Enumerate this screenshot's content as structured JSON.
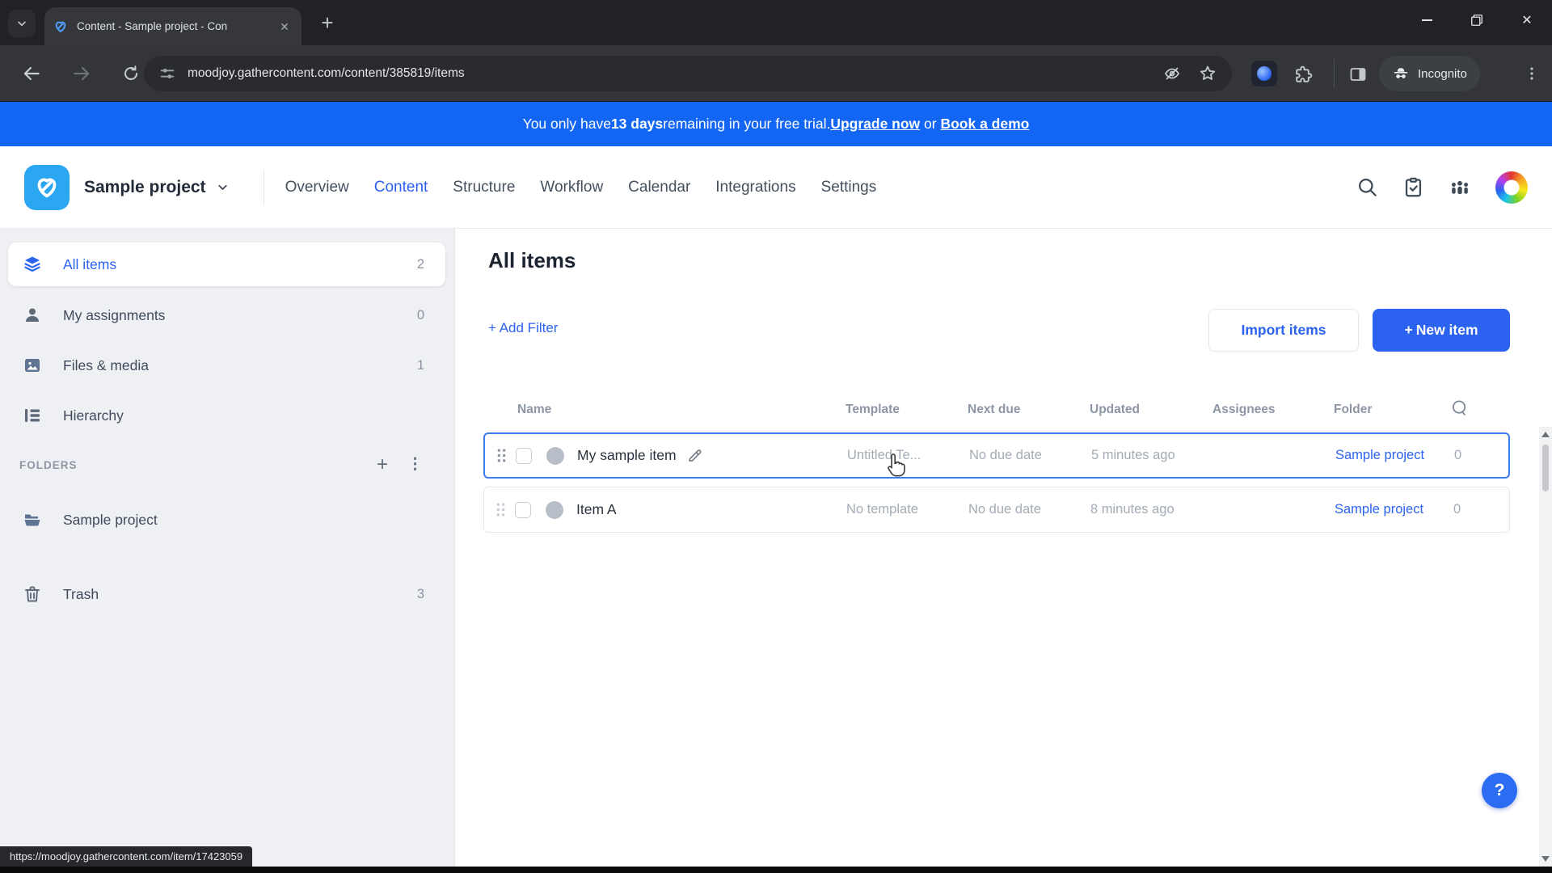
{
  "browser": {
    "tab_title": "Content - Sample project - Con",
    "url": "moodjoy.gathercontent.com/content/385819/items",
    "incognito_label": "Incognito",
    "status_link": "https://moodjoy.gathercontent.com/item/17423059"
  },
  "banner": {
    "text_prefix": "You only have ",
    "days_remaining": "13 days",
    "text_middle": " remaining in your free trial. ",
    "upgrade_link": "Upgrade now",
    "or_text": " or ",
    "demo_link": "Book a demo"
  },
  "header": {
    "project_name": "Sample project",
    "nav": [
      {
        "label": "Overview",
        "active": false
      },
      {
        "label": "Content",
        "active": true
      },
      {
        "label": "Structure",
        "active": false
      },
      {
        "label": "Workflow",
        "active": false
      },
      {
        "label": "Calendar",
        "active": false
      },
      {
        "label": "Integrations",
        "active": false
      },
      {
        "label": "Settings",
        "active": false
      }
    ]
  },
  "sidebar": {
    "items": [
      {
        "label": "All items",
        "count": "2",
        "icon": "layers-icon",
        "active": true
      },
      {
        "label": "My assignments",
        "count": "0",
        "icon": "person-icon",
        "active": false
      },
      {
        "label": "Files & media",
        "count": "1",
        "icon": "image-icon",
        "active": false
      },
      {
        "label": "Hierarchy",
        "count": "",
        "icon": "hierarchy-icon",
        "active": false
      }
    ],
    "folders_label": "FOLDERS",
    "folders": [
      {
        "label": "Sample project",
        "icon": "folder-icon"
      }
    ],
    "trash_label": "Trash",
    "trash_count": "3"
  },
  "main": {
    "title": "All items",
    "add_filter_label": "+ Add Filter",
    "import_button": "Import items",
    "new_item_plus": "+",
    "new_item_label": "New item",
    "help_label": "?",
    "table": {
      "columns": [
        "Name",
        "Template",
        "Next due",
        "Updated",
        "Assignees",
        "Folder"
      ],
      "rows": [
        {
          "name": "My sample item",
          "template": "Untitled Te...",
          "next_due": "No due date",
          "updated": "5 minutes ago",
          "assignees": "",
          "folder": "Sample project",
          "comments": "0"
        },
        {
          "name": "Item A",
          "template": "No template",
          "next_due": "No due date",
          "updated": "8 minutes ago",
          "assignees": "",
          "folder": "Sample project",
          "comments": "0"
        }
      ]
    }
  },
  "icons": {
    "close": "✕",
    "plus": "+",
    "kebab": "⋮"
  },
  "colors": {
    "accent_blue": "#2b63f0",
    "banner_blue": "#1366f3",
    "logo_blue": "#2ba6f0",
    "help_blue": "#2b6cf3",
    "chrome_dark": "#202226",
    "sidebar_gray": "#eef0f4"
  }
}
